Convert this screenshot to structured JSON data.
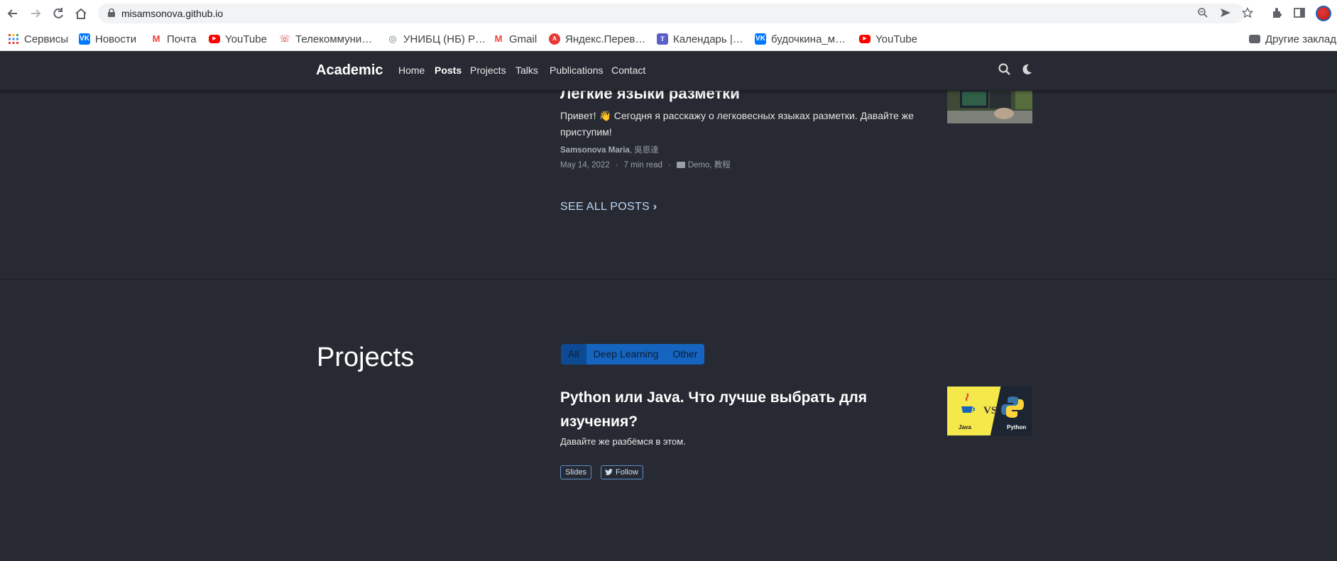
{
  "browser": {
    "url": "misamsonova.github.io",
    "bookmarks": [
      {
        "label": "Сервисы",
        "icon": "apps-grid-icon"
      },
      {
        "label": "Новости",
        "icon": "vk-icon"
      },
      {
        "label": "Почта",
        "icon": "gmail-icon"
      },
      {
        "label": "YouTube",
        "icon": "youtube-icon"
      },
      {
        "label": "Телекоммуни…",
        "icon": "telecom-icon"
      },
      {
        "label": "УНИБЦ (НБ) Р…",
        "icon": "library-icon"
      },
      {
        "label": "Gmail",
        "icon": "gmail-icon"
      },
      {
        "label": "Яндекс.Перев…",
        "icon": "yandex-translate-icon"
      },
      {
        "label": "Календарь |…",
        "icon": "teams-icon"
      },
      {
        "label": "будочкина_м…",
        "icon": "vk-icon"
      },
      {
        "label": "YouTube",
        "icon": "youtube-icon"
      },
      {
        "label": "Другие заклад",
        "icon": "folder-icon"
      }
    ]
  },
  "site": {
    "brand": "Academic",
    "nav": [
      "Home",
      "Posts",
      "Projects",
      "Talks",
      "Publications",
      "Contact"
    ],
    "active_nav": "Posts"
  },
  "post": {
    "title": "Легкие языки разметки",
    "summary": "Привет! 👋 Сегодня я расскажу о легковесных языках разметки. Давайте же приступим!",
    "author_main": "Samsonova Maria",
    "author_rest": ", 吳恩達",
    "date": "May 14, 2022",
    "read_time": "7 min read",
    "categories": "Demo, 教程",
    "see_all": "SEE ALL POSTS"
  },
  "projects": {
    "heading": "Projects",
    "filters": [
      "All",
      "Deep Learning",
      "Other"
    ],
    "active_filter": "All",
    "item": {
      "title": "Python или Java. Что лучше выбрать для изучения?",
      "summary": "Давайте же разбёмся в этом.",
      "thumb_left": "Java",
      "thumb_vs": "VS",
      "thumb_right": "Python",
      "slides_label": "Slides",
      "follow_label": "Follow"
    }
  },
  "colors": {
    "page_bg": "#272a32",
    "accent": "#1565c0",
    "link": "#bcd6f5"
  }
}
